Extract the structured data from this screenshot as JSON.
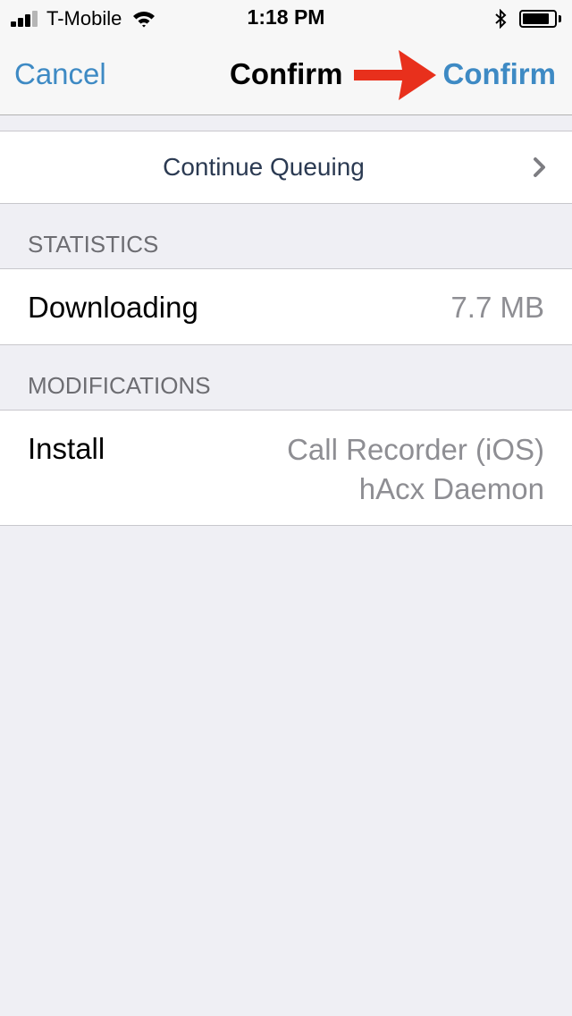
{
  "status_bar": {
    "carrier": "T-Mobile",
    "time": "1:18 PM",
    "battery_level": 0.85
  },
  "nav": {
    "cancel_label": "Cancel",
    "title": "Confirm",
    "confirm_label": "Confirm"
  },
  "queue": {
    "label": "Continue Queuing"
  },
  "statistics": {
    "header": "STATISTICS",
    "downloading_label": "Downloading",
    "downloading_value": "7.7 MB"
  },
  "modifications": {
    "header": "MODIFICATIONS",
    "install_label": "Install",
    "install_items": [
      "Call Recorder (iOS)",
      "hAcx Daemon"
    ]
  },
  "colors": {
    "accent": "#3e8ac4",
    "annotation_arrow": "#e8301c",
    "background": "#efeff4"
  }
}
